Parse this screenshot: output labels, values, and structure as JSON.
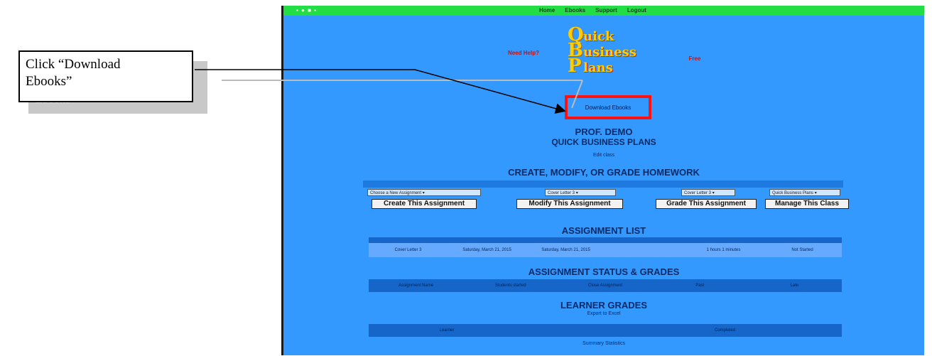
{
  "callout": {
    "text_line1": "Click “Download",
    "text_line2": "Ebooks”",
    "shadow_ghost_text": "Ebooks"
  },
  "app": {
    "topbar": {
      "nav": [
        "Home",
        "Ebooks",
        "Support",
        "Logout"
      ]
    },
    "banner_left": "Need Help?",
    "banner_right": "Free",
    "logo": {
      "q": "Q",
      "q_rest": "uick",
      "b": "B",
      "b_rest": "usiness",
      "p": "P",
      "p_rest": "lans"
    },
    "download_ebooks": "Download Ebooks",
    "prof_name": "PROF. DEMO",
    "class_name": "QUICK BUSINESS PLANS",
    "edit_class": "Edit class",
    "create_heading": "CREATE, MODIFY, OR GRADE HOMEWORK",
    "selects": {
      "create": "Choose a New Assignment",
      "modify": "Cover Letter 3",
      "grade": "Cover Letter 3",
      "manage": "Quick Business Plans"
    },
    "buttons": {
      "create": "Create This Assignment",
      "modify": "Modify This Assignment",
      "grade": "Grade This Assignment",
      "manage": "Manage This Class"
    },
    "list_heading": "ASSIGNMENT LIST",
    "list_row": {
      "name": "Cover Letter 3",
      "start": "Saturday, March 21, 2015",
      "due": "Saturday, March 21, 2015",
      "time": "1 hours 1 minutes",
      "status": "Not Started"
    },
    "status_heading": "ASSIGNMENT STATUS & GRADES",
    "status_row": {
      "name": "Assignment Name",
      "started": "Students started",
      "close": "Close Assignment",
      "past": "Past",
      "late": "Late"
    },
    "learner_heading": "LEARNER GRADES",
    "export": "Export to Excel",
    "learner_row": {
      "learner": "Learner",
      "completed": "Completed"
    },
    "summary": "Summary Statistics"
  },
  "colors": {
    "page_blue": "#3399ff",
    "topbar_green": "#22dd44",
    "highlight_red": "#ff1111",
    "logo_gold": "#ffcc00"
  }
}
